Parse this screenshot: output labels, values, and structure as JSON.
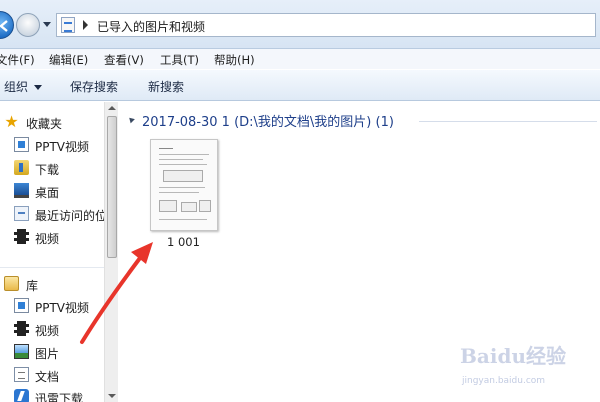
{
  "address_bar": {
    "path": "已导入的图片和视频"
  },
  "menu": {
    "items": [
      "文件(F)",
      "编辑(E)",
      "查看(V)",
      "工具(T)",
      "帮助(H)"
    ]
  },
  "command_bar": {
    "organize": "组织",
    "save_search": "保存搜索",
    "new_search": "新搜索"
  },
  "nav": {
    "favorites": {
      "label": "收藏夹",
      "items": [
        {
          "label": "PPTV视频",
          "icon": "pptv-icon"
        },
        {
          "label": "下载",
          "icon": "download-folder-icon"
        },
        {
          "label": "桌面",
          "icon": "desktop-icon"
        },
        {
          "label": "最近访问的位置",
          "icon": "recent-places-icon"
        },
        {
          "label": "视频",
          "icon": "video-icon"
        }
      ]
    },
    "libraries": {
      "label": "库",
      "items": [
        {
          "label": "PPTV视频",
          "icon": "pptv-icon"
        },
        {
          "label": "视频",
          "icon": "video-icon"
        },
        {
          "label": "图片",
          "icon": "picture-icon"
        },
        {
          "label": "文档",
          "icon": "document-icon"
        },
        {
          "label": "迅雷下载",
          "icon": "thunder-icon"
        }
      ]
    }
  },
  "content": {
    "group_header": "2017-08-30 1 (D:\\我的文档\\我的图片) (1)",
    "files": [
      {
        "name": "1 001"
      }
    ]
  },
  "colors": {
    "group_header": "#1e3f8a",
    "annotation_arrow": "#e8352b"
  },
  "watermark": {
    "text": "Baidu经验",
    "sub": "jingyan.baidu.com"
  }
}
